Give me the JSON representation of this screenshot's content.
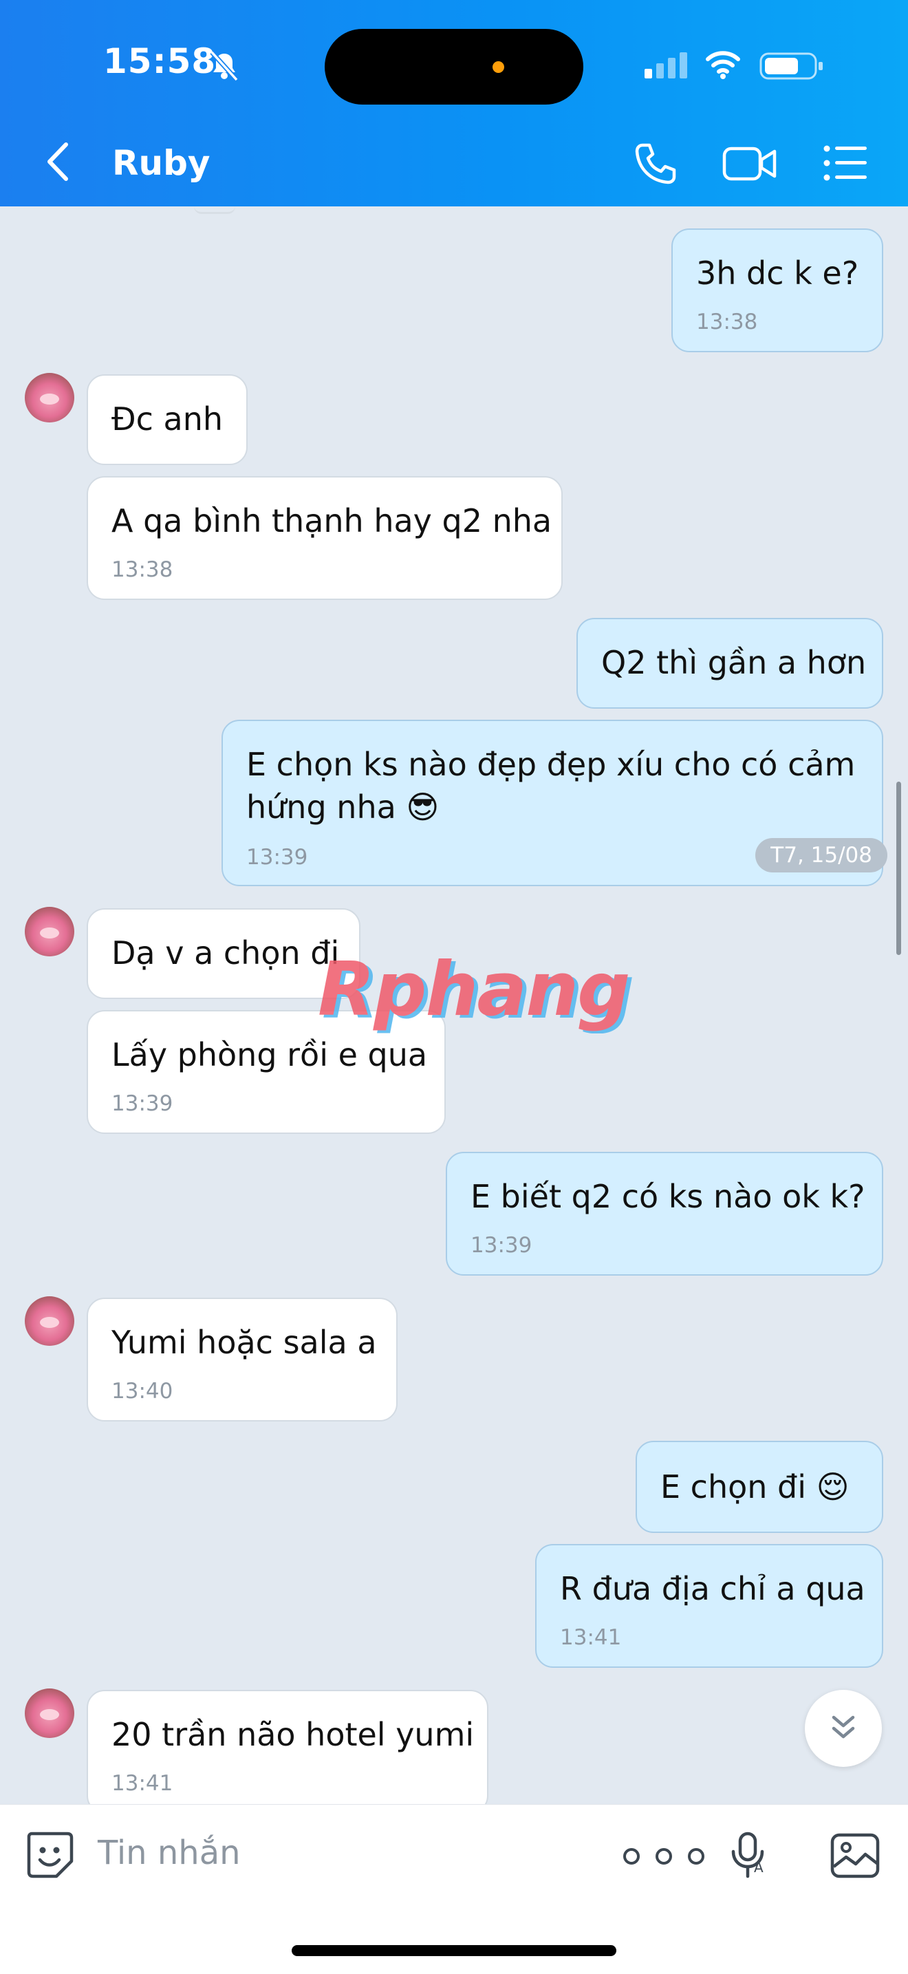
{
  "status_bar": {
    "time": "15:58"
  },
  "header": {
    "title": "Ruby"
  },
  "messages": [
    {
      "text": "3h dc k e?",
      "time": "13:38"
    },
    {
      "text": "Đc anh"
    },
    {
      "text": "A qa bình thạnh hay q2 nha",
      "time": "13:38"
    },
    {
      "text": "Q2 thì gần a hơn"
    },
    {
      "text": "E chọn ks nào đẹp đẹp xíu cho có cảm",
      "text2": "hứng nha",
      "emoji": "😎",
      "time": "13:39"
    },
    {
      "text": "Dạ v a chọn đi"
    },
    {
      "text": "Lấy phòng rồi e qua",
      "time": "13:39"
    },
    {
      "text": "E biết q2 có ks nào ok k?",
      "time": "13:39"
    },
    {
      "text": "Yumi hoặc sala a",
      "time": "13:40"
    },
    {
      "text": "E chọn đi",
      "emoji": "😌"
    },
    {
      "text": "R đưa địa chỉ a qua",
      "time": "13:41"
    },
    {
      "text": "20 trần não hotel yumi",
      "time": "13:41"
    }
  ],
  "date_separator": "T7, 15/08",
  "watermark": "Rphang",
  "composer": {
    "placeholder": "Tin nhắn"
  },
  "colors": {
    "header": "#0a92f5",
    "outgoing_bubble": "#d4efff",
    "incoming_bubble": "#ffffff",
    "background": "#e2e9f1"
  }
}
